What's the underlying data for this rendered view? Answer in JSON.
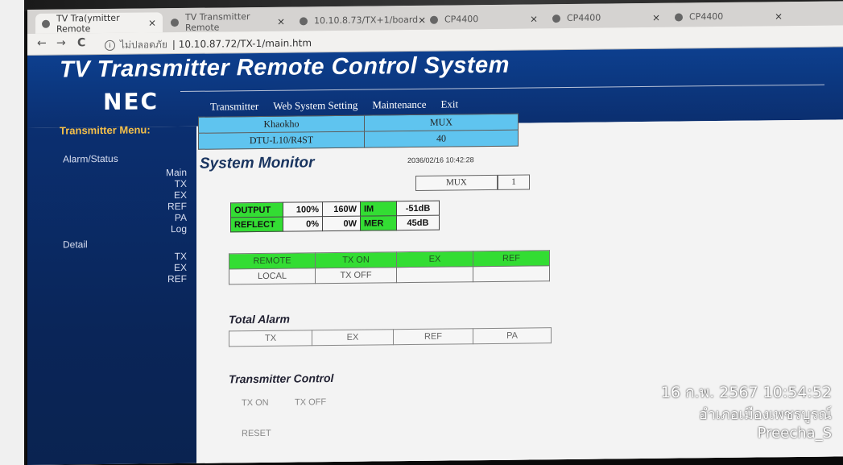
{
  "browser": {
    "tabs": [
      {
        "label": "TV Tra(ymitter Remote",
        "active": true
      },
      {
        "label": "TV Transmitter Remote",
        "active": false
      },
      {
        "label": "10.10.8.73/TX+1/board",
        "active": false
      },
      {
        "label": "CP4400",
        "active": false
      },
      {
        "label": "CP4400",
        "active": false
      },
      {
        "label": "CP4400",
        "active": false
      }
    ],
    "close_glyph": "×",
    "back_glyph": "←",
    "forward_glyph": "→",
    "reload_glyph": "C",
    "security_label": "ไม่ปลอดภัย",
    "url": "10.10.87.72/TX-1/main.htm"
  },
  "header": {
    "title": "TV Transmitter Remote Control System",
    "brand": "NEC",
    "nav": [
      "Transmitter",
      "Web System Setting",
      "Maintenance",
      "Exit"
    ]
  },
  "sidebar": {
    "menu_title": "Transmitter Menu:",
    "alarm_status_label": "Alarm/Status",
    "alarm_items": [
      "Main",
      "TX",
      "EX",
      "REF",
      "PA",
      "Log"
    ],
    "detail_label": "Detail",
    "detail_items": [
      "TX",
      "EX",
      "REF"
    ]
  },
  "main": {
    "info_table": [
      [
        "Khaokho",
        "MUX"
      ],
      [
        "DTU-L10/R4ST",
        "40"
      ]
    ],
    "section_title": "System Monitor",
    "datetime": "2036/02/16 10:42:28",
    "mux_label": "MUX",
    "mux_value": "1",
    "meter": [
      {
        "label": "OUTPUT",
        "percent": "100%",
        "power": "160W",
        "key": "IM",
        "value": "-51dB"
      },
      {
        "label": "REFLECT",
        "percent": "0%",
        "power": "0W",
        "key": "MER",
        "value": "45dB"
      }
    ],
    "status_row1": [
      "REMOTE",
      "TX ON",
      "EX",
      "REF"
    ],
    "status_row2": [
      "LOCAL",
      "TX OFF",
      "",
      ""
    ],
    "total_alarm_title": "Total Alarm",
    "alarms": [
      "TX",
      "EX",
      "REF",
      "PA"
    ],
    "control_title": "Transmitter Control",
    "control_on": "TX ON",
    "control_off": "TX OFF",
    "reset": "RESET"
  },
  "overlay": {
    "datetime": "16 ก.พ. 2567 10:54:52",
    "location": "อำเภอเมืองเพชรบูรณ์",
    "user": "Preecha_S"
  },
  "colors": {
    "header_blue": "#0d3f8e",
    "menu_title": "#f5c04a",
    "cyan_cell": "#5fc4ef",
    "status_green": "#33dd33"
  }
}
